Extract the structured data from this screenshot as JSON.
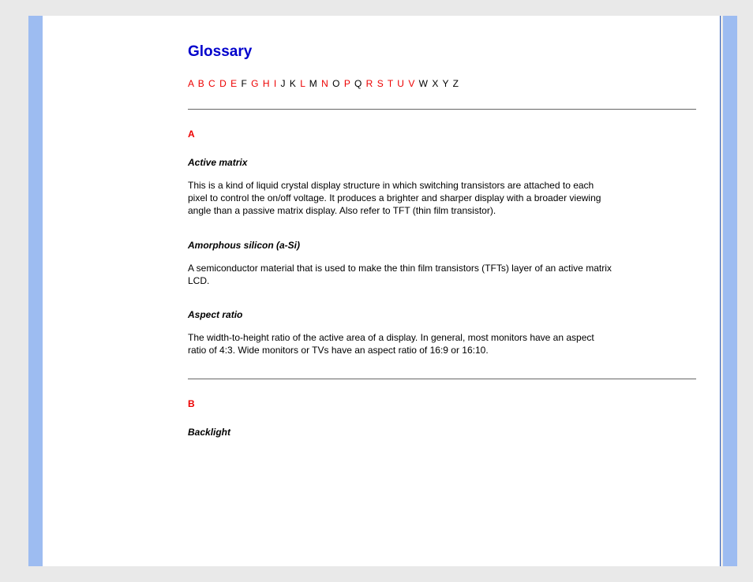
{
  "title": "Glossary",
  "alphabet": [
    {
      "t": "A",
      "link": true
    },
    {
      "t": "B",
      "link": true
    },
    {
      "t": "C",
      "link": true
    },
    {
      "t": "D",
      "link": true
    },
    {
      "t": "E",
      "link": true
    },
    {
      "t": "F",
      "link": false
    },
    {
      "t": "G",
      "link": true
    },
    {
      "t": "H",
      "link": true
    },
    {
      "t": "I",
      "link": true
    },
    {
      "t": "J",
      "link": false
    },
    {
      "t": "K",
      "link": false
    },
    {
      "t": "L",
      "link": true
    },
    {
      "t": "M",
      "link": false
    },
    {
      "t": "N",
      "link": true
    },
    {
      "t": "O",
      "link": false
    },
    {
      "t": "P",
      "link": true
    },
    {
      "t": "Q",
      "link": false
    },
    {
      "t": "R",
      "link": true
    },
    {
      "t": "S",
      "link": true
    },
    {
      "t": "T",
      "link": true
    },
    {
      "t": "U",
      "link": true
    },
    {
      "t": "V",
      "link": true
    },
    {
      "t": "W",
      "link": false
    },
    {
      "t": "X",
      "link": false
    },
    {
      "t": "Y",
      "link": false
    },
    {
      "t": "Z",
      "link": false
    }
  ],
  "sections": {
    "A": {
      "letter": "A",
      "entries": [
        {
          "term": "Active matrix",
          "def": "This is a kind of liquid crystal display structure in which switching transistors are attached to each pixel to control the on/off voltage. It produces a brighter and sharper display with a broader viewing angle than a passive matrix display. Also refer to TFT (thin film transistor)."
        },
        {
          "term": "Amorphous silicon (a-Si)",
          "def": "A semiconductor material that is used to make the thin film transistors (TFTs) layer of an active matrix LCD."
        },
        {
          "term": "Aspect ratio",
          "def": "The width-to-height ratio of the active area of a display. In general, most monitors have an aspect ratio of 4:3. Wide monitors or TVs have an aspect ratio of 16:9 or 16:10."
        }
      ]
    },
    "B": {
      "letter": "B",
      "entries": [
        {
          "term": "Backlight",
          "def": ""
        }
      ]
    }
  }
}
